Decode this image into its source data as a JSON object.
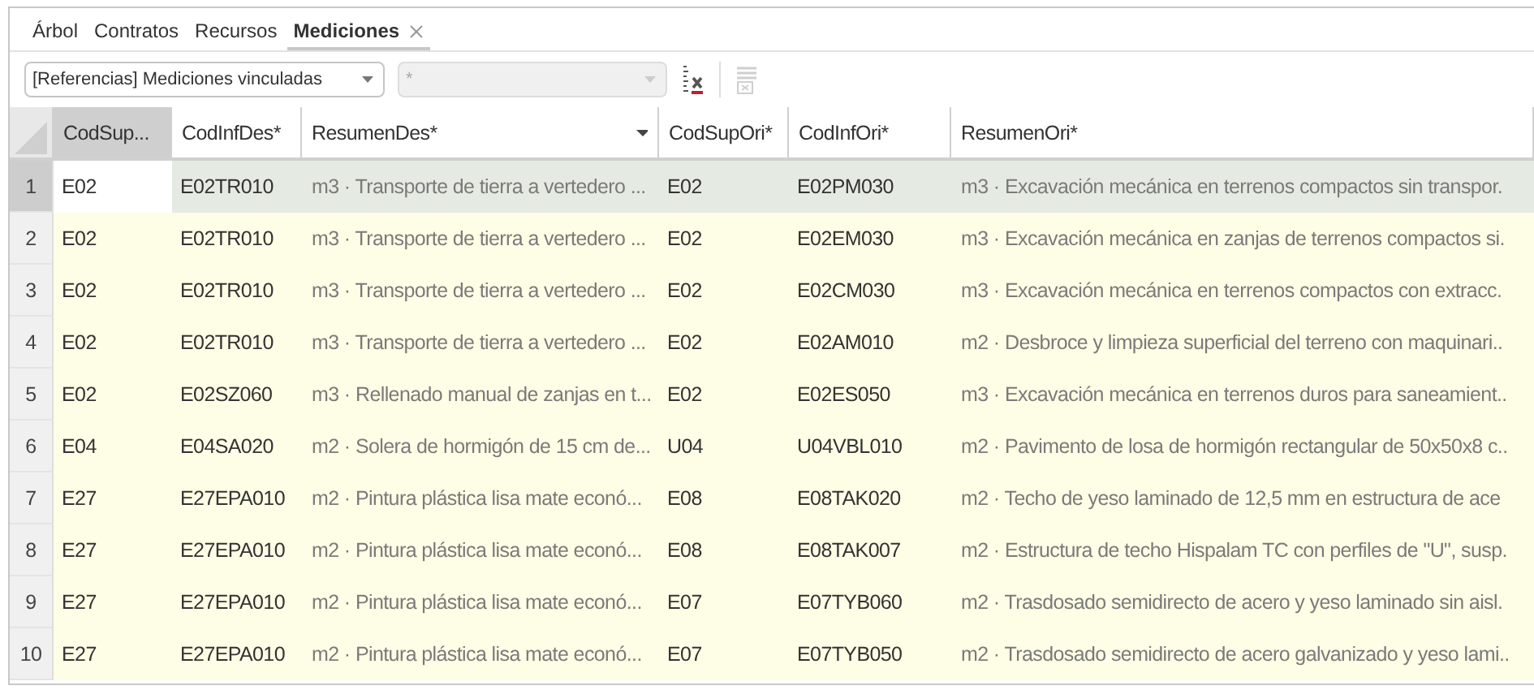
{
  "tabs": [
    {
      "label": "Árbol",
      "selected": false,
      "closable": false
    },
    {
      "label": "Contratos",
      "selected": false,
      "closable": false
    },
    {
      "label": "Recursos",
      "selected": false,
      "closable": false
    },
    {
      "label": "Mediciones",
      "selected": true,
      "closable": true
    }
  ],
  "toolbar": {
    "view_select": {
      "value": "[Referencias] Mediciones vinculadas",
      "disabled": false
    },
    "filter_select": {
      "value": "*",
      "disabled": true
    },
    "clear_filter_disabled": false,
    "remove_disabled": true
  },
  "table": {
    "columns": [
      {
        "label": "CodSup...",
        "selected": true,
        "menu": false
      },
      {
        "label": "CodInfDes*",
        "selected": false,
        "menu": false
      },
      {
        "label": "ResumenDes*",
        "selected": false,
        "menu": true
      },
      {
        "label": "CodSupOri*",
        "selected": false,
        "menu": false
      },
      {
        "label": "CodInfOri*",
        "selected": false,
        "menu": false
      },
      {
        "label": "ResumenOri*",
        "selected": false,
        "menu": false
      }
    ],
    "rows": [
      {
        "number": "1",
        "selected": true,
        "cells": [
          "E02",
          "E02TR010",
          "m3 · Transporte de tierra a vertedero ...",
          "E02",
          "E02PM030",
          "m3 · Excavación mecánica en terrenos compactos sin transpor."
        ]
      },
      {
        "number": "2",
        "selected": false,
        "cells": [
          "E02",
          "E02TR010",
          "m3 · Transporte de tierra a vertedero ...",
          "E02",
          "E02EM030",
          "m3 · Excavación mecánica en zanjas de terrenos compactos si."
        ]
      },
      {
        "number": "3",
        "selected": false,
        "cells": [
          "E02",
          "E02TR010",
          "m3 · Transporte de tierra a vertedero ...",
          "E02",
          "E02CM030",
          "m3 · Excavación mecánica en terrenos compactos con extracc."
        ]
      },
      {
        "number": "4",
        "selected": false,
        "cells": [
          "E02",
          "E02TR010",
          "m3 · Transporte de tierra a vertedero ...",
          "E02",
          "E02AM010",
          "m2 · Desbroce y limpieza superficial del terreno con maquinari.."
        ]
      },
      {
        "number": "5",
        "selected": false,
        "cells": [
          "E02",
          "E02SZ060",
          "m3 · Rellenado manual de zanjas en t...",
          "E02",
          "E02ES050",
          "m3 · Excavación mecánica en terrenos duros para saneamient.."
        ]
      },
      {
        "number": "6",
        "selected": false,
        "cells": [
          "E04",
          "E04SA020",
          "m2 · Solera de hormigón de 15 cm de...",
          "U04",
          "U04VBL010",
          "m2 · Pavimento de losa de hormigón rectangular de 50x50x8 c.."
        ]
      },
      {
        "number": "7",
        "selected": false,
        "cells": [
          "E27",
          "E27EPA010",
          "m2 · Pintura plástica lisa mate econó...",
          "E08",
          "E08TAK020",
          "m2 · Techo de yeso laminado de 12,5 mm en estructura de ace"
        ]
      },
      {
        "number": "8",
        "selected": false,
        "cells": [
          "E27",
          "E27EPA010",
          "m2 · Pintura plástica lisa mate econó...",
          "E08",
          "E08TAK007",
          "m2 · Estructura de techo Hispalam TC con perfiles de \"U\", susp."
        ]
      },
      {
        "number": "9",
        "selected": false,
        "cells": [
          "E27",
          "E27EPA010",
          "m2 · Pintura plástica lisa mate econó...",
          "E07",
          "E07TYB060",
          "m2 · Trasdosado semidirecto de acero y yeso laminado sin aisl."
        ]
      },
      {
        "number": "10",
        "selected": false,
        "cells": [
          "E27",
          "E27EPA010",
          "m2 · Pintura plástica lisa mate econó...",
          "E07",
          "E07TYB050",
          "m2 · Trasdosado semidirecto de acero galvanizado y yeso lami.."
        ]
      }
    ]
  }
}
